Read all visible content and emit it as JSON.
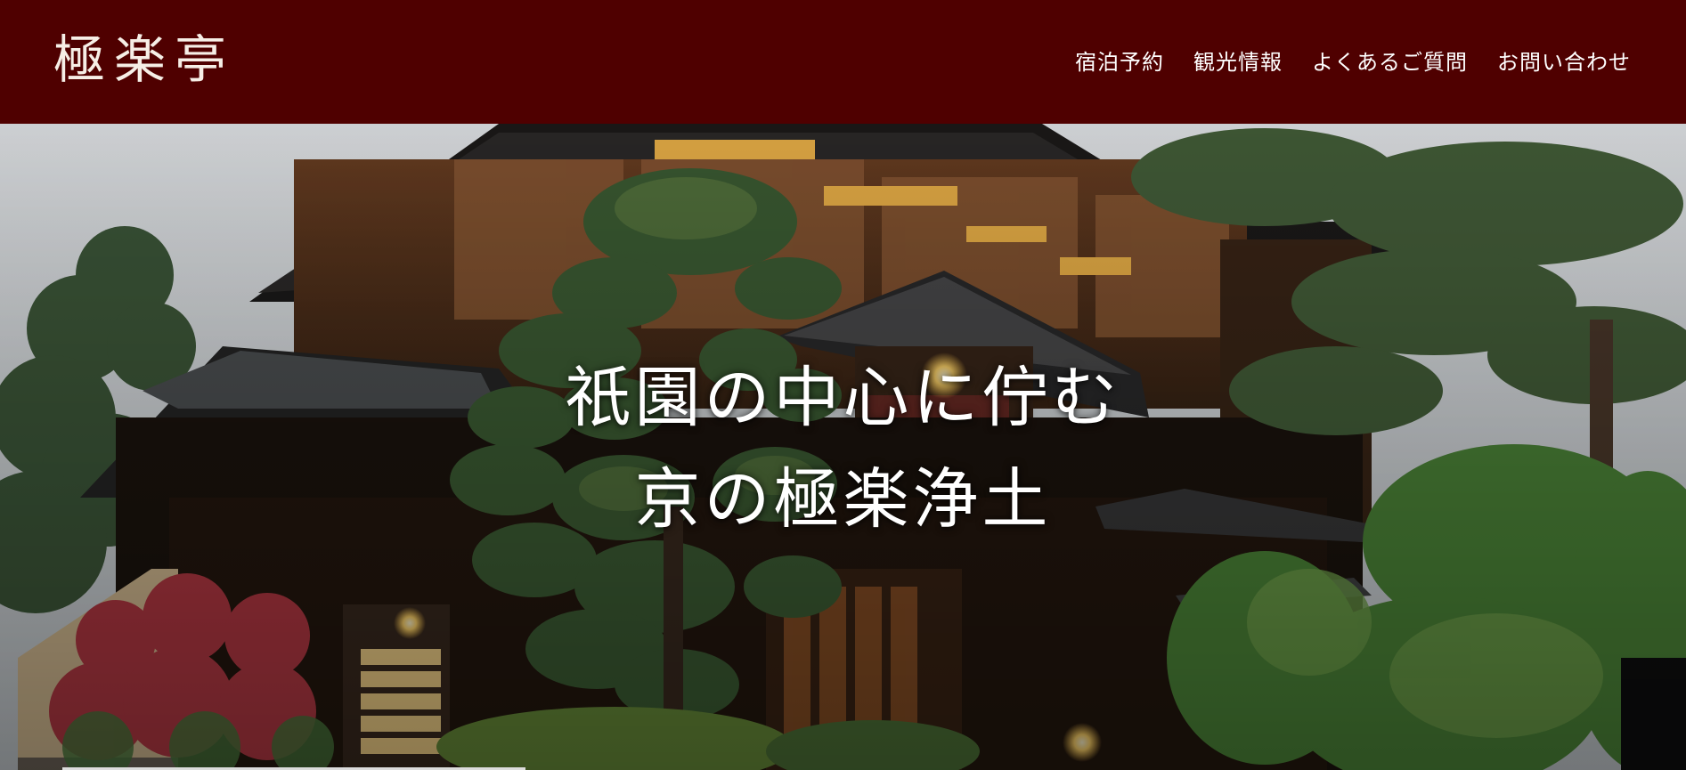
{
  "header": {
    "logo": "極楽亭",
    "nav": [
      {
        "label": "宿泊予約"
      },
      {
        "label": "観光情報"
      },
      {
        "label": "よくあるご質問"
      },
      {
        "label": "お問い合わせ"
      }
    ]
  },
  "hero": {
    "line1": "祇園の中心に佇む",
    "line2": "京の極楽浄土"
  },
  "colors": {
    "header_bg": "#4f0000",
    "text": "#ffffff"
  }
}
